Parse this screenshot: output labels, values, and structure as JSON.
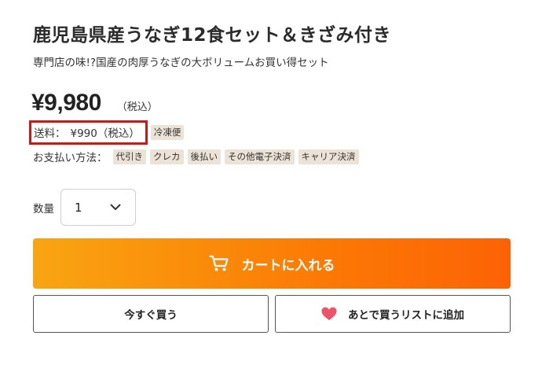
{
  "product": {
    "title": "鹿児島県産うなぎ12食セット＆きざみ付き",
    "subtitle": "専門店の味!?国産の肉厚うなぎの大ボリュームお買い得セット",
    "price": "¥9,980",
    "tax_note": "（税込）"
  },
  "shipping": {
    "label": "送料：",
    "fee": "¥990（税込）",
    "tag": "冷凍便",
    "highlight_color": "#e01010"
  },
  "payment": {
    "label": "お支払い方法：",
    "methods": [
      "代引き",
      "クレカ",
      "後払い",
      "その他電子決済",
      "キャリア決済"
    ]
  },
  "quantity": {
    "label": "数量",
    "selected": "1",
    "icon": "chevron-down-icon"
  },
  "buttons": {
    "add_to_cart": "カートに入れる",
    "cart_icon": "cart-icon",
    "buy_now": "今すぐ買う",
    "wishlist": "あとで買うリストに追加",
    "heart_icon": "heart-icon"
  },
  "colors": {
    "cart_gradient_start": "#f9a512",
    "cart_gradient_end": "#fc6205",
    "tag_background": "#ece3d6",
    "heart": "#f0526a"
  }
}
